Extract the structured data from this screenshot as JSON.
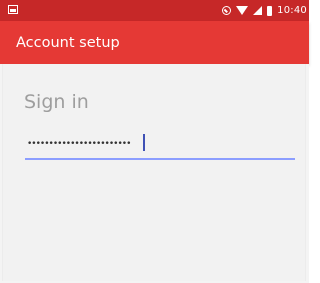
{
  "status_bar": {
    "time": "10:40",
    "icons": [
      "notification-icon",
      "do-not-disturb-icon",
      "wifi-icon",
      "signal-icon",
      "battery-icon"
    ],
    "color": "#c62828"
  },
  "action_bar": {
    "title": "Account setup",
    "color": "#e53935"
  },
  "main": {
    "heading": "Sign in",
    "password_field": {
      "value": "••••••••••••••••••••••••",
      "underline_color": "#8c9eff",
      "cursor_color": "#3f51b5"
    }
  }
}
